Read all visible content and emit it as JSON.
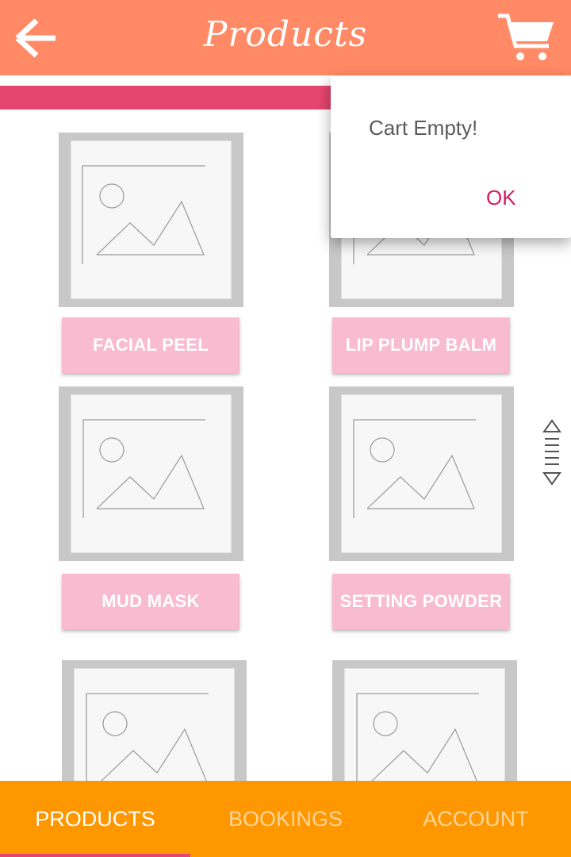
{
  "header": {
    "title": "Products",
    "back_icon": "arrow-left-icon",
    "cart_icon": "shopping-cart-icon"
  },
  "colors": {
    "header": "#ff8a65",
    "accent_strip": "#e5466f",
    "label_button": "#f8bbd0",
    "bottom_nav": "#ff9800",
    "ok_text": "#d81b60"
  },
  "products": [
    {
      "label": "FACIAL PEEL"
    },
    {
      "label": "LIP PLUMP BALM"
    },
    {
      "label": "MUD MASK"
    },
    {
      "label": "SETTING POWDER"
    }
  ],
  "dialog": {
    "message": "Cart Empty!",
    "ok_label": "OK"
  },
  "bottom_nav": {
    "tabs": [
      {
        "label": "PRODUCTS",
        "active": true
      },
      {
        "label": "BOOKINGS",
        "active": false
      },
      {
        "label": "ACCOUNT",
        "active": false
      }
    ]
  }
}
